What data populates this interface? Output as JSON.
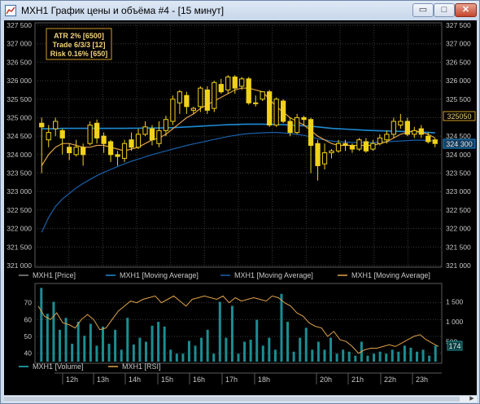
{
  "window": {
    "title": "MXH1 График цены и объёма #4 - [15 минут]",
    "buttons": {
      "minimize": "▭",
      "maximize": "□",
      "close": "✕"
    }
  },
  "colors": {
    "candle": "#f1d21b",
    "ma_fast": "#e0a24a",
    "ma_mid": "#1e8bd4",
    "ma_slow": "#1a5fa8",
    "volume": "#1b8d92",
    "rsi": "#e0a24a",
    "grid": "#3c3c3c",
    "axis_text": "#c8c8c8",
    "info_border": "#d19b2a"
  },
  "info_box": {
    "line1": "ATR 2% [6500]",
    "line2": "Trade 6/3/3 [12]",
    "line3": "Risk 0.16% [650]"
  },
  "price_axis": {
    "left_labels": [
      "327 500",
      "327 000",
      "326 500",
      "326 000",
      "325 500",
      "325 000",
      "324 500",
      "324 000",
      "323 500",
      "323 000",
      "322 500",
      "322 000",
      "321 500",
      "321 000"
    ],
    "right_labels": [
      "327 500",
      "327 000",
      "326 500",
      "326 000",
      "325 500",
      "325 000",
      "324 500",
      "324 000",
      "323 500",
      "323 000",
      "322 500",
      "322 000",
      "321 500",
      "321 000"
    ],
    "tag_upper": "325050",
    "tag_lower": "324 300"
  },
  "legend_top": [
    "MXH1 [Price]",
    "MXH1 [Moving Average]",
    "MXH1 [Moving Average]",
    "MXH1 [Moving Average]"
  ],
  "lower_axis": {
    "left_labels": [
      "70",
      "60",
      "50",
      "40"
    ],
    "right_labels": [
      "1 500",
      "1 000",
      "500"
    ],
    "tag_right": "174"
  },
  "legend_bottom": [
    "MXH1 [Volume]",
    "MXH1 [RSI]"
  ],
  "time_axis": {
    "labels": [
      "12h",
      "13h",
      "14h",
      "15h",
      "16h",
      "17h",
      "18h",
      "20h",
      "21h",
      "22h",
      "23h"
    ]
  },
  "chart_data": {
    "type": "line",
    "title": "",
    "price": {
      "ylim": [
        321000,
        327500
      ],
      "candles": [
        [
          324850,
          324750,
          325000,
          323500
        ],
        [
          324400,
          324600,
          324800,
          324200
        ],
        [
          324700,
          324900,
          325000,
          324500
        ],
        [
          324650,
          324450,
          324700,
          324000
        ],
        [
          324200,
          324050,
          324300,
          323850
        ],
        [
          324000,
          324200,
          324400,
          323950
        ],
        [
          324200,
          324000,
          324300,
          323700
        ],
        [
          324300,
          324800,
          324900,
          324250
        ],
        [
          324850,
          324450,
          324950,
          324300
        ],
        [
          324500,
          324300,
          324600,
          324050
        ],
        [
          324350,
          324000,
          324400,
          323800
        ],
        [
          324000,
          323950,
          324100,
          323700
        ],
        [
          323900,
          324300,
          324400,
          323800
        ],
        [
          324400,
          324200,
          324600,
          324100
        ],
        [
          324200,
          324550,
          324700,
          324150
        ],
        [
          324550,
          324750,
          324900,
          324500
        ],
        [
          324700,
          324400,
          324800,
          324250
        ],
        [
          324300,
          324650,
          324900,
          324200
        ],
        [
          324650,
          324950,
          325050,
          324500
        ],
        [
          324900,
          325500,
          325600,
          324800
        ],
        [
          325400,
          325700,
          325750,
          325100
        ],
        [
          325600,
          325300,
          325700,
          325100
        ],
        [
          325200,
          325250,
          325300,
          325100
        ],
        [
          325300,
          325800,
          325850,
          325150
        ],
        [
          325750,
          325200,
          325850,
          325100
        ],
        [
          325250,
          325950,
          326000,
          325150
        ],
        [
          325900,
          325700,
          326050,
          325650
        ],
        [
          325750,
          326100,
          326150,
          325650
        ],
        [
          326100,
          325800,
          326150,
          325650
        ],
        [
          325850,
          326050,
          326100,
          325750
        ],
        [
          326050,
          325400,
          326100,
          325350
        ],
        [
          325400,
          325400,
          325600,
          325300
        ],
        [
          325500,
          325700,
          325700,
          325450
        ],
        [
          325700,
          324800,
          325750,
          324750
        ],
        [
          324800,
          325500,
          325550,
          324750
        ],
        [
          325450,
          324900,
          325500,
          324850
        ],
        [
          324900,
          324600,
          325000,
          324500
        ],
        [
          324600,
          325000,
          325100,
          324550
        ],
        [
          325000,
          324950,
          325050,
          324800
        ],
        [
          324950,
          324250,
          325000,
          323500
        ],
        [
          324300,
          323700,
          324400,
          323300
        ],
        [
          323750,
          324050,
          324300,
          323600
        ],
        [
          324050,
          324100,
          324150,
          323900
        ],
        [
          324100,
          324300,
          324400,
          324050
        ],
        [
          324300,
          324250,
          324400,
          324100
        ],
        [
          324250,
          324150,
          324300,
          324050
        ],
        [
          324150,
          324400,
          324450,
          324100
        ],
        [
          324350,
          324100,
          324450,
          324050
        ],
        [
          324150,
          324300,
          324400,
          324100
        ],
        [
          324300,
          324450,
          324550,
          324250
        ],
        [
          324400,
          324550,
          324650,
          324300
        ],
        [
          324550,
          324900,
          325000,
          324450
        ],
        [
          324800,
          324900,
          325100,
          324700
        ],
        [
          324900,
          324550,
          325000,
          324500
        ],
        [
          324550,
          324650,
          324750,
          324450
        ],
        [
          324700,
          324550,
          324800,
          324450
        ],
        [
          324500,
          324350,
          324600,
          324300
        ],
        [
          324400,
          324300,
          324450,
          324200
        ]
      ],
      "ma_fast": [
        323700,
        324000,
        324200,
        324300,
        324300,
        324250,
        324200,
        324200,
        324250,
        324250,
        324200,
        324150,
        324100,
        324150,
        324200,
        324300,
        324400,
        324450,
        324550,
        324700,
        324850,
        325000,
        325100,
        325250,
        325350,
        325450,
        325550,
        325650,
        325750,
        325800,
        325800,
        325750,
        325700,
        325500,
        325300,
        325150,
        325000,
        324900,
        324800,
        324650,
        324500,
        324400,
        324300,
        324250,
        324250,
        324250,
        324250,
        324250,
        324250,
        324300,
        324350,
        324450,
        324550,
        324600,
        324650,
        324600,
        324550,
        324450
      ],
      "ma_mid": [
        324700,
        324700,
        324700,
        324710,
        324710,
        324710,
        324710,
        324710,
        324710,
        324710,
        324710,
        324710,
        324710,
        324715,
        324715,
        324720,
        324720,
        324720,
        324725,
        324730,
        324740,
        324750,
        324760,
        324770,
        324780,
        324790,
        324800,
        324810,
        324815,
        324820,
        324825,
        324825,
        324825,
        324820,
        324815,
        324810,
        324800,
        324790,
        324780,
        324770,
        324750,
        324730,
        324710,
        324700,
        324690,
        324680,
        324670,
        324660,
        324650,
        324645,
        324640,
        324635,
        324630,
        324625,
        324620,
        324610,
        324600,
        324590
      ],
      "ma_slow": [
        321900,
        322300,
        322600,
        322800,
        322950,
        323100,
        323220,
        323330,
        323430,
        323520,
        323600,
        323680,
        323750,
        323820,
        323880,
        323940,
        324000,
        324050,
        324100,
        324150,
        324200,
        324250,
        324290,
        324330,
        324370,
        324410,
        324450,
        324490,
        324520,
        324550,
        324570,
        324580,
        324590,
        324600,
        324600,
        324590,
        324570,
        324550,
        324520,
        324480,
        324430,
        324400,
        324370,
        324350,
        324340,
        324330,
        324330,
        324330,
        324330,
        324340,
        324350,
        324360,
        324370,
        324380,
        324390,
        324390,
        324380,
        324370
      ]
    },
    "volume": {
      "ylim": [
        0,
        1900
      ],
      "values": [
        1850,
        1200,
        1500,
        800,
        1100,
        450,
        1000,
        650,
        950,
        400,
        880,
        450,
        800,
        300,
        1100,
        430,
        600,
        500,
        900,
        1000,
        880,
        300,
        200,
        200,
        520,
        400,
        600,
        800,
        200,
        1500,
        600,
        1400,
        200,
        500,
        550,
        1050,
        400,
        600,
        300,
        1700,
        1000,
        250,
        600,
        850,
        300,
        500,
        300,
        600,
        200,
        300,
        250,
        150,
        500,
        150,
        200,
        250,
        200,
        300,
        250,
        400,
        350,
        250,
        300,
        150,
        400
      ]
    },
    "rsi": {
      "ylim": [
        35,
        80
      ],
      "values": [
        68,
        62,
        60,
        64,
        58,
        57,
        55,
        60,
        63,
        60,
        54,
        55,
        60,
        65,
        68,
        71,
        70,
        72,
        73,
        74,
        70,
        72,
        74,
        71,
        68,
        72,
        73,
        74,
        73,
        72,
        74,
        70,
        73,
        71,
        72,
        73,
        72,
        71,
        74,
        73,
        70,
        68,
        64,
        62,
        58,
        56,
        55,
        50,
        53,
        48,
        47,
        44,
        40,
        42,
        43,
        43,
        44,
        45,
        44,
        46,
        48,
        50,
        51,
        48,
        46,
        44
      ]
    }
  }
}
